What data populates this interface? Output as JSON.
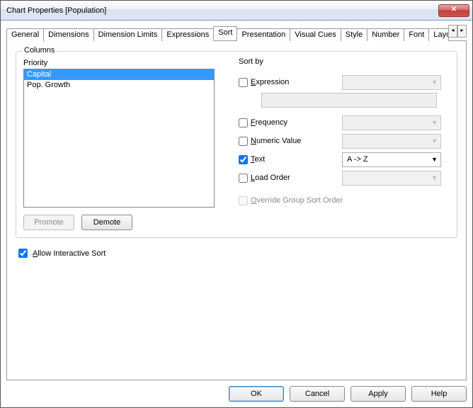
{
  "title": "Chart Properties [Population]",
  "close_glyph": "✕",
  "tabs": {
    "general": "General",
    "dimensions": "Dimensions",
    "dimension_limits": "Dimension Limits",
    "expressions": "Expressions",
    "sort": "Sort",
    "presentation": "Presentation",
    "visual_cues": "Visual Cues",
    "style": "Style",
    "number": "Number",
    "font": "Font",
    "layout": "Layo",
    "scroll_left": "◂",
    "scroll_right": "▸"
  },
  "columns_group_label": "Columns",
  "priority_label": "Priority",
  "priority_items": [
    {
      "label": "Capital",
      "selected": true
    },
    {
      "label": "Pop. Growth",
      "selected": false
    }
  ],
  "buttons": {
    "promote": "Promote",
    "demote": "Demote"
  },
  "sortby_label": "Sort by",
  "sort_options": {
    "expression": {
      "label": "Expression",
      "checked": false,
      "combo": "",
      "combo_enabled": false
    },
    "frequency": {
      "label": "Frequency",
      "checked": false,
      "combo": "",
      "combo_enabled": false
    },
    "numeric": {
      "label": "Numeric Value",
      "checked": false,
      "combo": "",
      "combo_enabled": false
    },
    "text": {
      "label": "Text",
      "checked": true,
      "combo": "A -> Z",
      "combo_enabled": true
    },
    "load": {
      "label": "Load Order",
      "checked": false,
      "combo": "",
      "combo_enabled": false
    },
    "override": {
      "label": "Override Group Sort Order",
      "checked": false,
      "enabled": false
    }
  },
  "allow_interactive": {
    "label": "Allow Interactive Sort",
    "checked": true
  },
  "footer": {
    "ok": "OK",
    "cancel": "Cancel",
    "apply": "Apply",
    "help": "Help"
  }
}
